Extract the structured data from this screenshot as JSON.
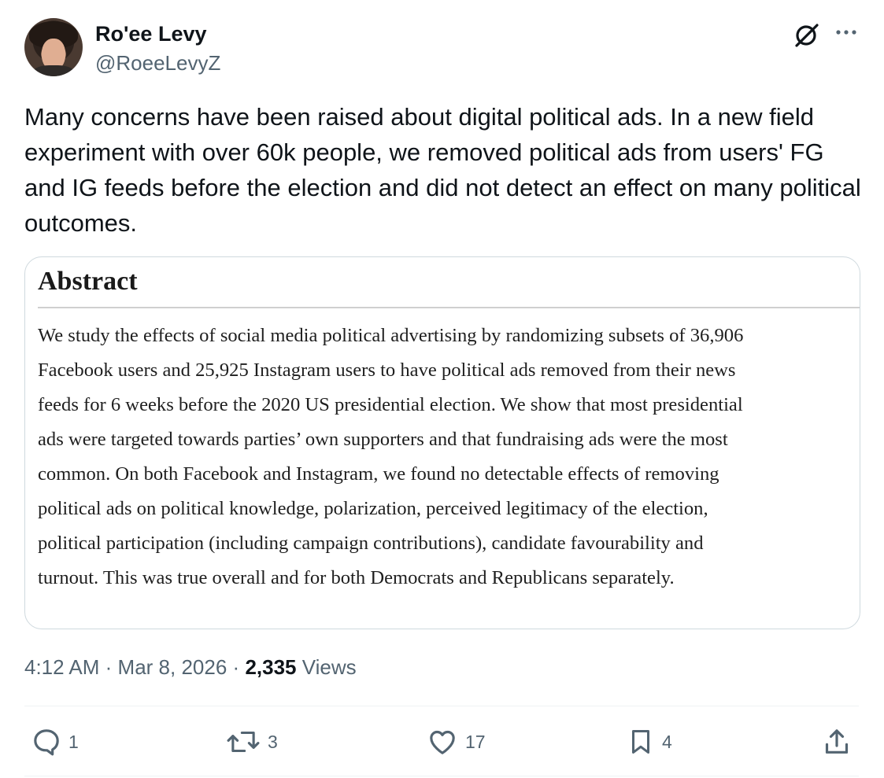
{
  "author": {
    "name": "Ro'ee Levy",
    "handle": "@RoeeLevyZ"
  },
  "tweet": {
    "text": "Many concerns have been raised about digital political ads. In a new field experiment with over 60k people, we removed political ads from users' FG and IG feeds before the election and did not detect an effect on many political outcomes."
  },
  "image_card": {
    "heading": "Abstract",
    "lines": [
      "We study the effects of social media political advertising by randomizing subsets of 36,906",
      "Facebook users and 25,925 Instagram users to have political ads removed from their news",
      "feeds for 6 weeks before the 2020 US presidential election. We show that most presidential",
      "ads were targeted towards parties’ own supporters and that fundraising ads were the most",
      "common. On both Facebook and Instagram, we found no detectable effects of removing",
      "political ads on political knowledge, polarization, perceived legitimacy of the election,",
      "political participation (including campaign contributions), candidate favourability and",
      "turnout. This was true overall and for both Democrats and Republicans separately."
    ]
  },
  "meta": {
    "time": "4:12 AM",
    "date": "Mar 8, 2026",
    "views_count": "2,335",
    "views_label": "Views",
    "sep": "·"
  },
  "actions": {
    "replies": "1",
    "reposts": "3",
    "likes": "17",
    "bookmarks": "4"
  },
  "icons": [
    "avatar",
    "grok-icon",
    "more-icon",
    "reply-icon",
    "repost-icon",
    "like-icon",
    "bookmark-icon",
    "share-icon"
  ]
}
